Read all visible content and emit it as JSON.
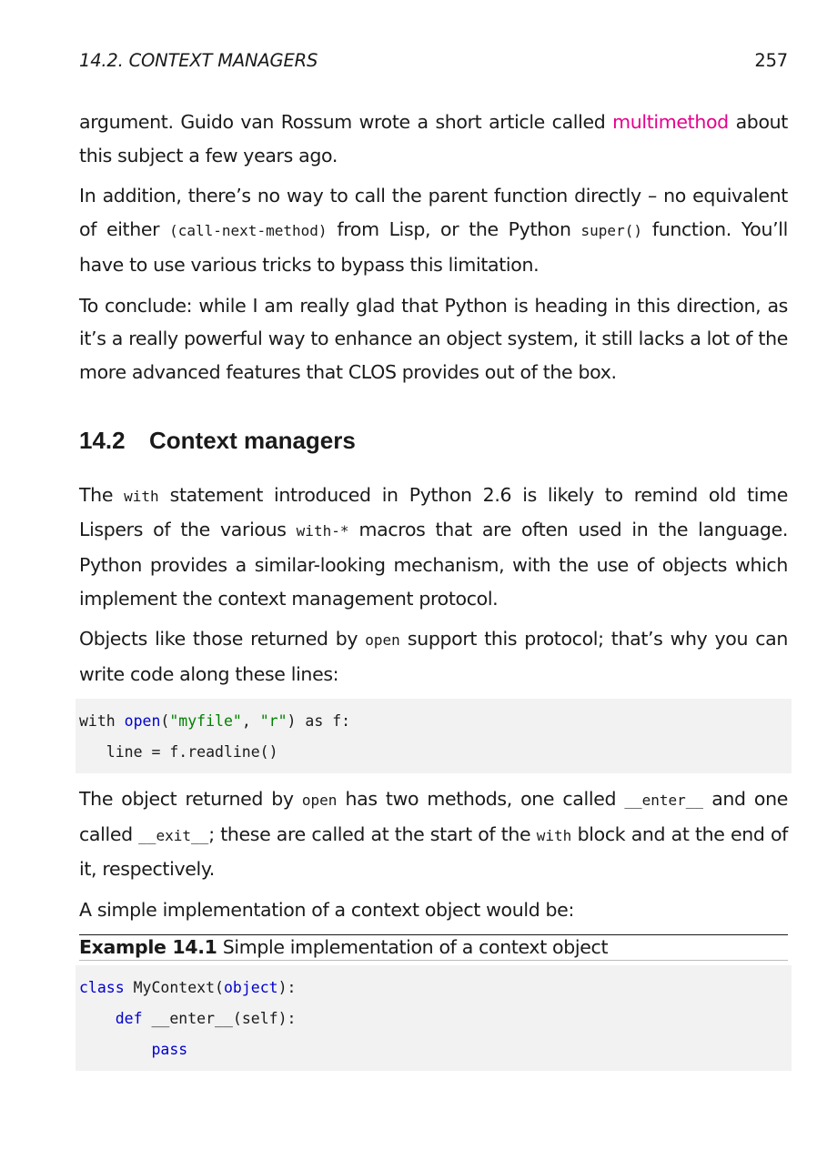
{
  "header": {
    "section_title": "14.2. CONTEXT MANAGERS",
    "page_number": "257"
  },
  "para1": {
    "t1": "argument. Guido van Rossum wrote a short article called ",
    "link": "multimethod",
    "t2": " about this subject a few years ago."
  },
  "para2": {
    "t1": "In addition, there’s no way to call the parent function directly – no equivalent of either ",
    "c1": "(call-next-method)",
    "t2": " from Lisp, or the Python ",
    "c2": "super()",
    "t3": " function. You’ll have to use various tricks to bypass this limitation."
  },
  "para3": {
    "text": "To conclude: while I am really glad that Python is heading in this direction, as it’s a really powerful way to enhance an object system, it still lacks a lot of the more advanced features that CLOS provides out of the box."
  },
  "section": {
    "number": "14.2",
    "title": "Context managers"
  },
  "para4": {
    "t1": "The ",
    "c1": "with",
    "t2": " statement introduced in Python 2.6 is likely to remind old time Lispers of the various ",
    "c2": "with-*",
    "t3": " macros that are often used in the language. Python provides a similar-looking mechanism, with the use of objects which implement the context management protocol."
  },
  "para5": {
    "t1": "Objects like those returned by ",
    "c1": "open",
    "t2": " support this protocol; that’s why you can write code along these lines:"
  },
  "code1": {
    "l1_kw": "with ",
    "l1_fn": "open",
    "l1_p1": "(",
    "l1_s1": "\"myfile\"",
    "l1_p2": ", ",
    "l1_s2": "\"r\"",
    "l1_p3": ") as f:",
    "l2": "   line = f.readline()"
  },
  "para6": {
    "t1": "The object returned by ",
    "c1": "open",
    "t2": " has two methods, one called ",
    "c2": "__enter__",
    "t3": " and one called ",
    "c3": "__exit__",
    "t4": "; these are called at the start of the ",
    "c4": "with",
    "t5": " block and at the end of it, respectively."
  },
  "para7": {
    "text": "A simple implementation of a context object would be:"
  },
  "example": {
    "label": "Example 14.1",
    "caption": " Simple implementation of a context object"
  },
  "code2": {
    "l1_kw": "class",
    "l1_t1": " MyContext(",
    "l1_kw2": "object",
    "l1_t2": "):",
    "l2_indent": "    ",
    "l2_kw": "def",
    "l2_t": " __enter__(self):",
    "l3_indent": "        ",
    "l3_kw": "pass"
  },
  "colors": {
    "link": "#e5008c",
    "keyword": "#0000cc",
    "string": "#008000",
    "code_bg": "#f2f2f2"
  }
}
